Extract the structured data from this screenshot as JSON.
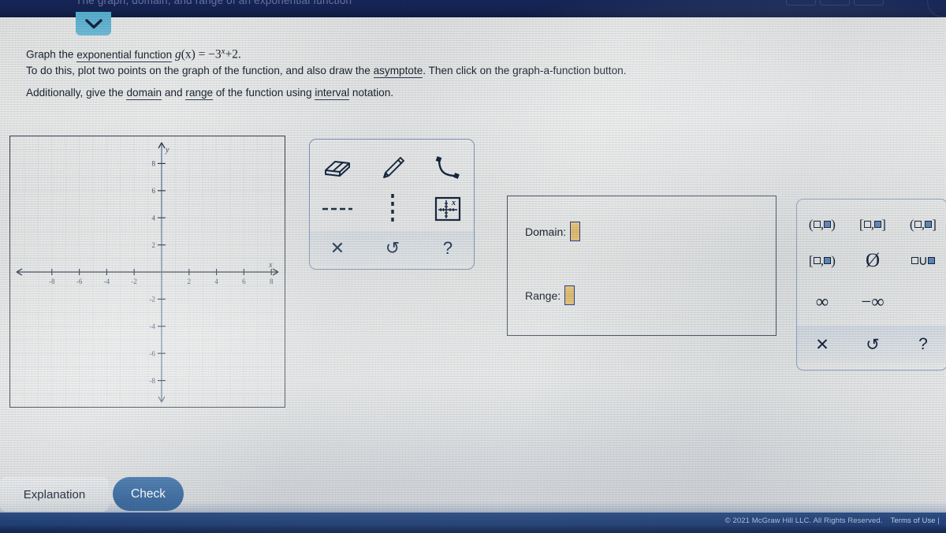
{
  "window": {
    "title": "The graph, domain, and range of an exponential function"
  },
  "collapse_tab": {
    "icon": "chevron-down-icon"
  },
  "question": {
    "line1_prefix": "Graph the ",
    "line1_link": "exponential function",
    "line1_fn_name": "g",
    "line1_fn_arg": "(x)",
    "line1_equals": "= −3",
    "line1_exponent": "x",
    "line1_tail": "+2.",
    "line2_a": "To do this, plot two points on the graph of the function, and also draw the ",
    "line2_link": "asymptote",
    "line2_b": ". Then click on the graph-a-function button.",
    "line3_a": "Additionally, give the ",
    "line3_link1": "domain",
    "line3_b": " and ",
    "line3_link2": "range",
    "line3_c": " of the function using ",
    "line3_link3": "interval",
    "line3_d": " notation."
  },
  "graph": {
    "x_axis_label": "x",
    "y_axis_label": "y",
    "x_ticks": [
      -8,
      -6,
      -4,
      -2,
      2,
      4,
      6,
      8
    ],
    "y_ticks": [
      8,
      6,
      4,
      2,
      -2,
      -4,
      -6,
      -8
    ],
    "x_range": [
      -9.5,
      9.5
    ],
    "y_range": [
      -9.5,
      9.5
    ],
    "grid": true
  },
  "toolbar": {
    "tools": [
      {
        "name": "eraser-icon",
        "label": "Eraser"
      },
      {
        "name": "pencil-icon",
        "label": "Pencil"
      },
      {
        "name": "curve-icon",
        "label": "Curve"
      },
      {
        "name": "dashed-line-icon",
        "label": "Dashed line"
      },
      {
        "name": "dotted-line-icon",
        "label": "Dotted line"
      },
      {
        "name": "graph-a-function-icon",
        "label": "Graph a function"
      }
    ],
    "actions": [
      {
        "name": "clear-icon",
        "glyph": "✕"
      },
      {
        "name": "undo-icon",
        "glyph": "↺"
      },
      {
        "name": "help-icon",
        "glyph": "?"
      }
    ]
  },
  "answer": {
    "domain_label": "Domain:",
    "domain_value": "",
    "range_label": "Range:",
    "range_value": ""
  },
  "keypad": {
    "row1": [
      {
        "name": "open-open-interval",
        "open": "(",
        "close": ")"
      },
      {
        "name": "closed-closed-interval",
        "open": "[",
        "close": "]"
      },
      {
        "name": "open-closed-interval",
        "open": "(",
        "close": "]"
      }
    ],
    "row2_interval": {
      "name": "closed-open-interval",
      "open": "[",
      "close": ")"
    },
    "row2_empty_set": "Ø",
    "row2_union": "∪",
    "row3": [
      {
        "name": "infinity",
        "glyph": "∞"
      },
      {
        "name": "negative-infinity",
        "glyph": "−∞"
      }
    ],
    "row4": [
      {
        "name": "clear-icon",
        "glyph": "✕"
      },
      {
        "name": "undo-icon",
        "glyph": "↺"
      },
      {
        "name": "help-icon",
        "glyph": "?"
      }
    ]
  },
  "actions": {
    "explanation_label": "Explanation",
    "check_label": "Check"
  },
  "footer": {
    "copyright": "© 2021 McGraw Hill LLC. All Rights Reserved.",
    "terms": "Terms of Use",
    "divider": "|"
  }
}
